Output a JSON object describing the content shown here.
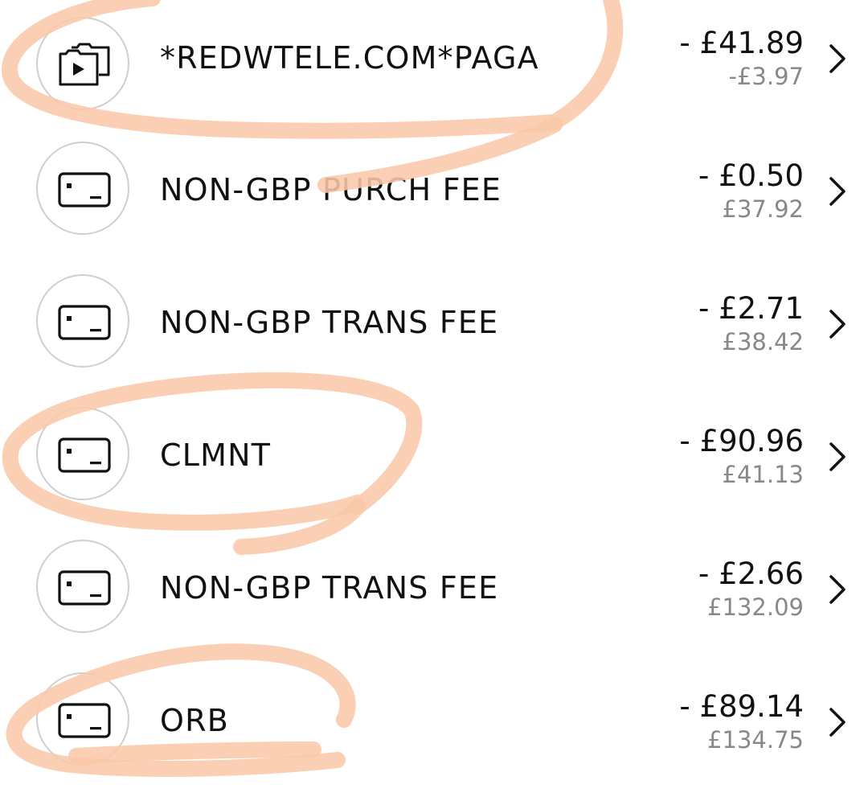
{
  "annotation_color": "#f9c8a8",
  "transactions": [
    {
      "icon": "entertainment-icon",
      "merchant": "*REDWTELE.COM*PAGA",
      "amount": "- £41.89",
      "balance": "-£3.97"
    },
    {
      "icon": "card-icon",
      "merchant": "NON-GBP PURCH FEE",
      "amount": "- £0.50",
      "balance": "£37.92"
    },
    {
      "icon": "card-icon",
      "merchant": "NON-GBP TRANS FEE",
      "amount": "- £2.71",
      "balance": "£38.42"
    },
    {
      "icon": "card-icon",
      "merchant": "CLMNT",
      "amount": "- £90.96",
      "balance": "£41.13"
    },
    {
      "icon": "card-icon",
      "merchant": "NON-GBP TRANS FEE",
      "amount": "- £2.66",
      "balance": "£132.09"
    },
    {
      "icon": "card-icon",
      "merchant": "ORB",
      "amount": "- £89.14",
      "balance": "£134.75"
    }
  ]
}
